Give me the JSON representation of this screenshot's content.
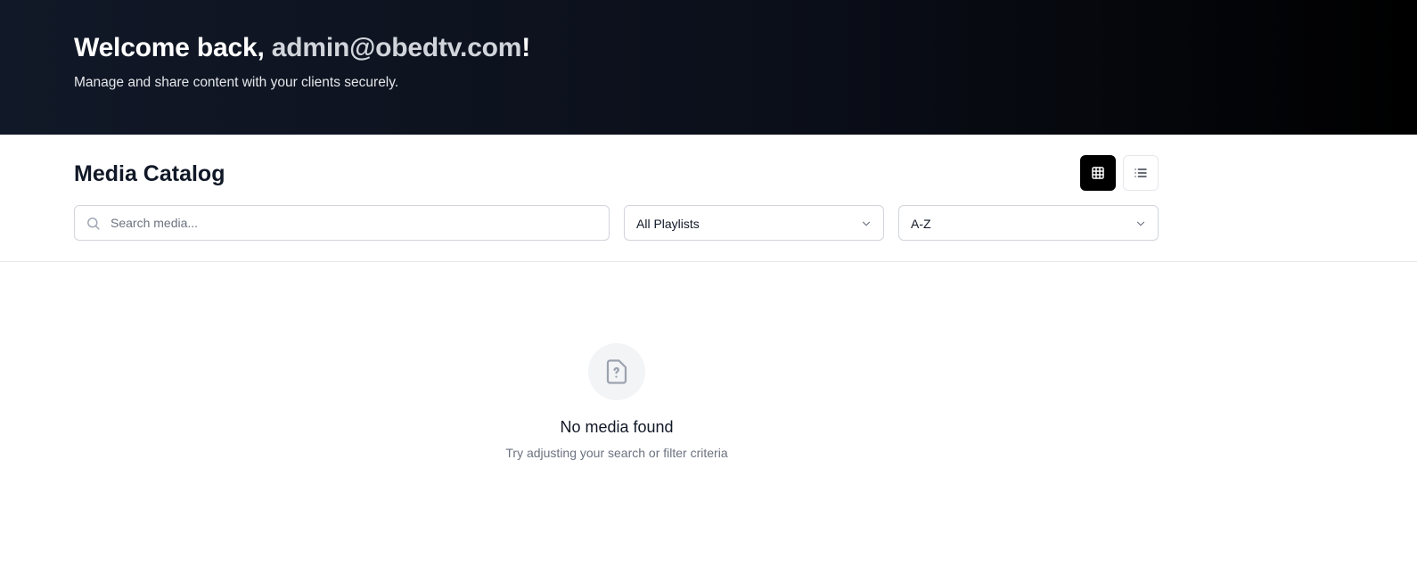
{
  "hero": {
    "greeting": "Welcome back, ",
    "email": "admin@obedtv.com",
    "exclaim": "!",
    "subtitle": "Manage and share content with your clients securely."
  },
  "catalog": {
    "title": "Media Catalog",
    "view_modes": [
      {
        "name": "grid",
        "icon": "grid-icon",
        "active": true
      },
      {
        "name": "list",
        "icon": "list-icon",
        "active": false
      }
    ],
    "search": {
      "placeholder": "Search media...",
      "value": "",
      "icon": "search-icon"
    },
    "playlist_filter": {
      "selected": "All Playlists",
      "icon": "chevron-down-icon"
    },
    "sort": {
      "selected": "A-Z",
      "icon": "chevron-down-icon"
    }
  },
  "empty_state": {
    "icon": "file-question-icon",
    "title": "No media found",
    "subtitle": "Try adjusting your search or filter criteria"
  },
  "colors": {
    "hero_start": "#111827",
    "hero_end": "#000000",
    "active_button": "#000000",
    "muted_text": "#6b7280"
  }
}
